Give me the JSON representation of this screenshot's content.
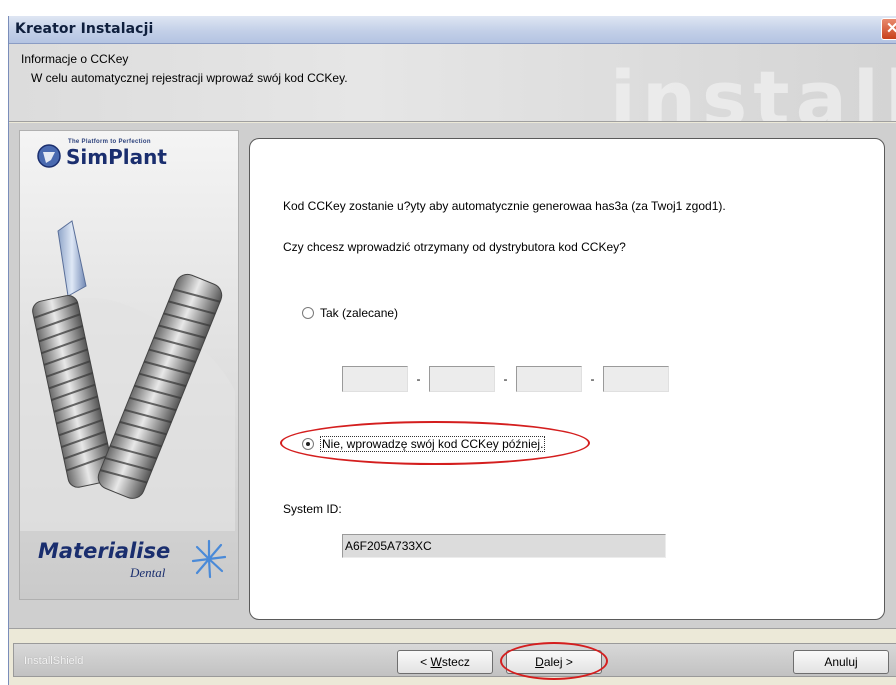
{
  "window": {
    "title": "Kreator Instalacji"
  },
  "header": {
    "title": "Informacje o CCKey",
    "subtitle": "W celu automatycznej rejestracji wprowaź swój kod CCKey.",
    "watermark": "install"
  },
  "branding": {
    "tagline": "The Platform to Perfection",
    "product": "SimPlant",
    "maker": "Materialise",
    "maker_sub": "Dental"
  },
  "content": {
    "info_text": "Kod CCKey zostanie u?yty aby automatycznie generowaa has3a (za Twoj1 zgod1).",
    "question": "Czy chcesz wprowadzić otrzymany od dystrybutora kod CCKey?",
    "option_yes": "Tak (zalecane)",
    "option_no": "Nie, wprowadzę swój kod CCKey później.",
    "selected_option": "option_no",
    "key_fields": [
      "",
      "",
      "",
      ""
    ],
    "key_separator": "-",
    "system_id_label": "System ID:",
    "system_id_value": "A6F205A733XC"
  },
  "footer": {
    "installshield": "InstallShield",
    "back_prefix": "< ",
    "back_mnemonic": "W",
    "back_rest": "stecz",
    "next_mnemonic": "D",
    "next_rest": "alej >",
    "cancel": "Anuluj"
  },
  "colors": {
    "annotation": "#d41e1e",
    "brand": "#1a2e6e"
  }
}
